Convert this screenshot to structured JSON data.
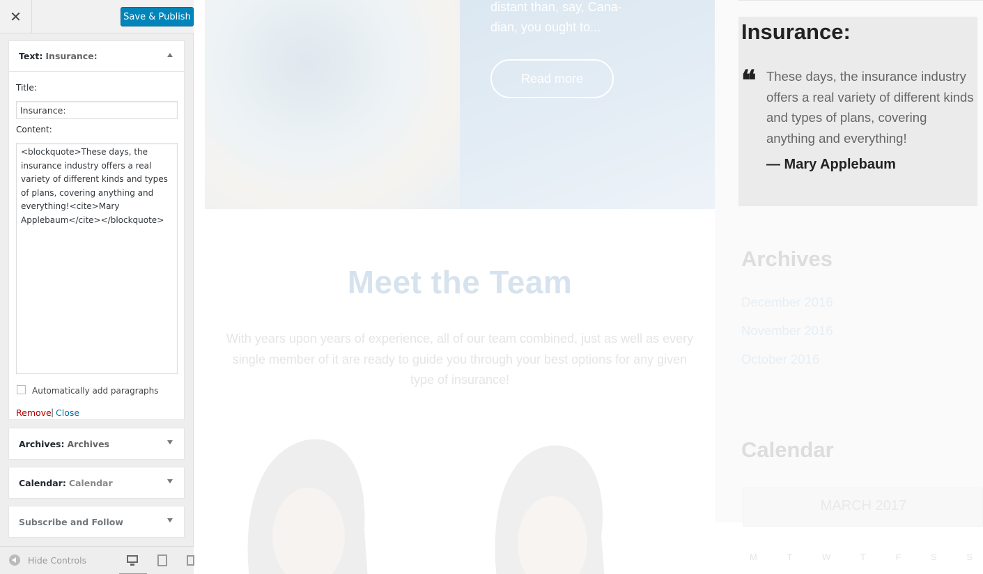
{
  "customizer": {
    "close_label": "✕",
    "publish_label": "Save & Publish",
    "widgets": {
      "text": {
        "type_label": "Text:",
        "name": "Insurance:",
        "title_label": "Title:",
        "title_value": "Insurance:",
        "content_label": "Content:",
        "content_value": "<blockquote>These days, the insurance industry offers a real variety of different kinds and types of plans, covering anything and everything!<cite>Mary Applebaum</cite></blockquote>",
        "auto_paragraphs_label": "Automatically add paragraphs",
        "auto_paragraphs_checked": false,
        "remove_label": "Remove",
        "separator": "|",
        "close_label": "Close"
      },
      "archives": {
        "type_label": "Archives:",
        "name": "Archives"
      },
      "calendar": {
        "type_label": "Calendar:",
        "name": "Calendar"
      },
      "subscribe": {
        "type_label": "Subscribe and Follow"
      }
    },
    "footer": {
      "hide_controls_label": "Hide Controls",
      "devices": [
        "desktop-icon",
        "tablet-icon",
        "mobile-icon"
      ]
    }
  },
  "preview": {
    "hero": {
      "excerpt": "distant than, say, Cana-dian, you ought to...",
      "read_more_label": "Read more"
    },
    "team": {
      "title": "Meet the Team",
      "text": "With years upon years of experience, all of our team combined, just as well as every single member of it are ready to guide you through your best options for any given type of insurance!"
    },
    "insurance_widget": {
      "title": "Insurance:",
      "quote": "These days, the insurance industry offers a real variety of different kinds and types of plans, covering anything and everything!",
      "cite": "— Mary Applebaum"
    },
    "archives_widget": {
      "title": "Archives",
      "links": [
        "December 2016",
        "November 2016",
        "October 2016"
      ]
    },
    "calendar_widget": {
      "title": "Calendar",
      "month": "MARCH 2017",
      "days": [
        "M",
        "T",
        "W",
        "T",
        "F",
        "S",
        "S"
      ]
    }
  },
  "colors": {
    "publish_button": "#0085ba",
    "remove_link": "#aa0000",
    "close_link": "#0073aa"
  }
}
